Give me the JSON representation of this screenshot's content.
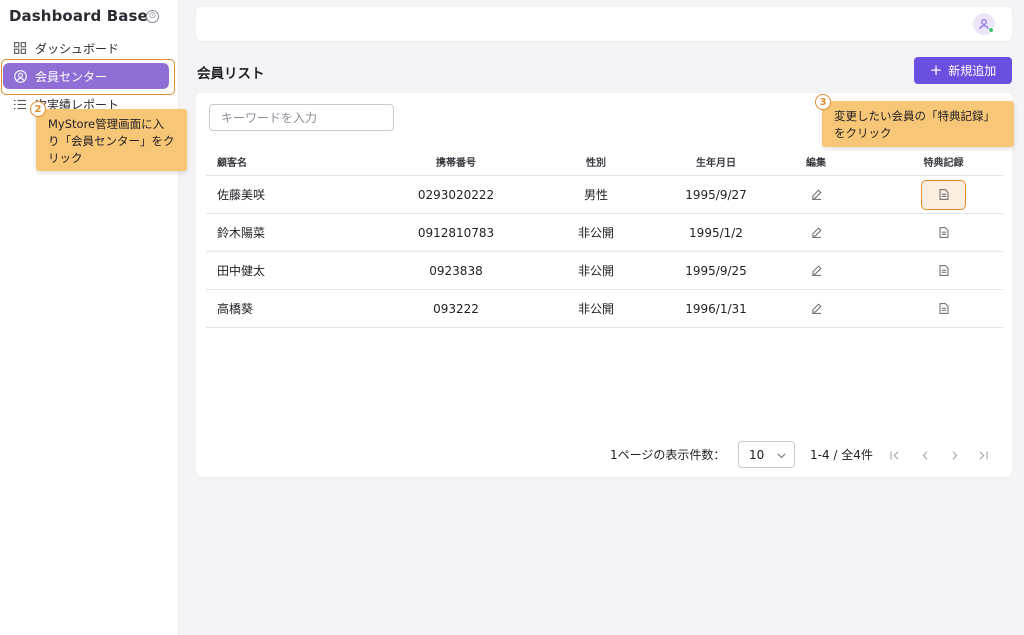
{
  "sidebar": {
    "brand": "Dashboard Base",
    "items": [
      {
        "label": "ダッシュボード",
        "icon": "grid-icon"
      },
      {
        "label": "会員センター",
        "icon": "user-circle-icon",
        "active": true
      },
      {
        "label": "次実績レポート",
        "icon": "list-icon"
      }
    ]
  },
  "callouts": {
    "step2": {
      "number": "2",
      "text": "MyStore管理画面に入り「会員センター」をクリック"
    },
    "step3": {
      "number": "3",
      "text": "変更したい会員の「特典記録」をクリック"
    }
  },
  "header": {
    "avatar_icon": "user-icon"
  },
  "main": {
    "title": "会員リスト",
    "new_button": "新規追加",
    "search_placeholder": "キーワードを入力"
  },
  "table": {
    "columns": {
      "name": "顧客名",
      "phone": "携帯番号",
      "gender": "性別",
      "birthday": "生年月日",
      "edit": "編集",
      "perks": "特典記録"
    },
    "rows": [
      {
        "name": "佐藤美咲",
        "phone": "0293020222",
        "gender": "男性",
        "birthday": "1995/9/27"
      },
      {
        "name": "鈴木陽菜",
        "phone": "0912810783",
        "gender": "非公開",
        "birthday": "1995/1/2"
      },
      {
        "name": "田中健太",
        "phone": "0923838",
        "gender": "非公開",
        "birthday": "1995/9/25"
      },
      {
        "name": "高橋葵",
        "phone": "093222",
        "gender": "非公開",
        "birthday": "1996/1/31"
      }
    ]
  },
  "pagination": {
    "per_page_label": "1ページの表示件数：",
    "per_page_value": "10",
    "range": "1-4 / 全4件"
  },
  "colors": {
    "accent": "#6a4fe0",
    "active_nav": "#8f6fd6",
    "callout": "#f7c676",
    "highlight": "#e08b2c"
  }
}
